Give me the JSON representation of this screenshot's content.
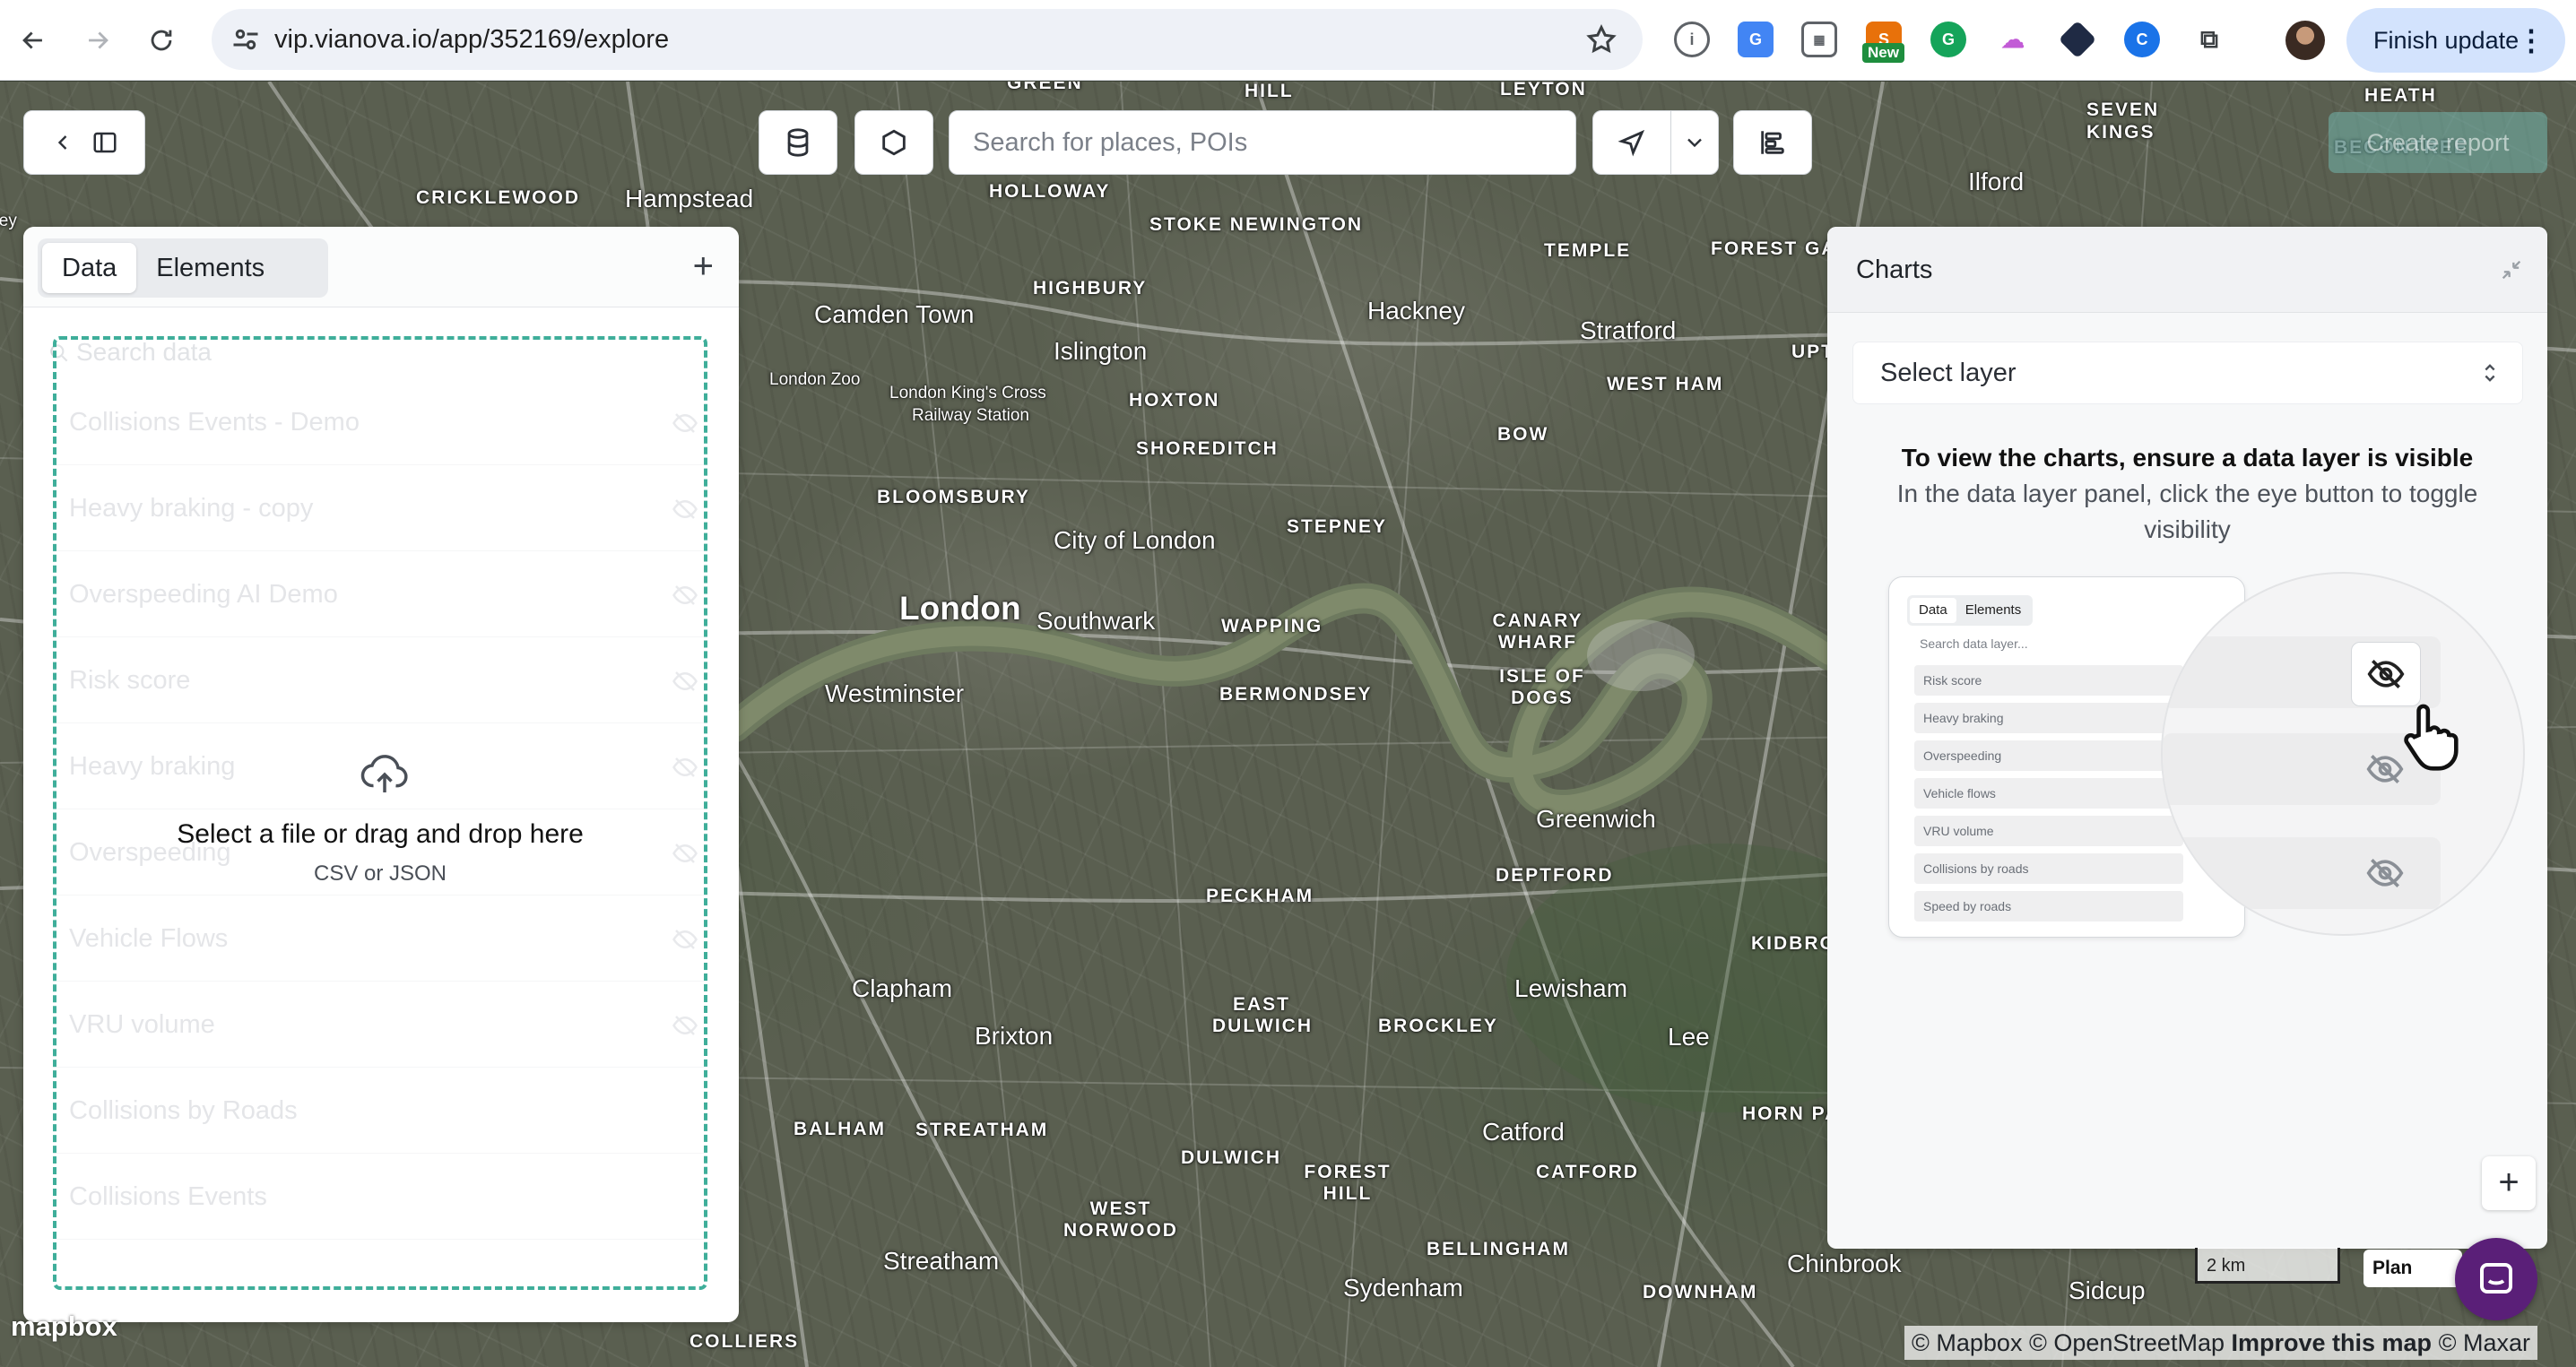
{
  "browser": {
    "url": "vip.vianova.io/app/352169/explore",
    "finish_update": "Finish update",
    "ext_new_badge": "New"
  },
  "toolbar": {
    "search_placeholder": "Search for places, POIs",
    "create_report": "Create report"
  },
  "left_panel": {
    "tabs": [
      {
        "label": "Data",
        "active": true
      },
      {
        "label": "Elements",
        "active": false
      }
    ],
    "search_placeholder": "Search data",
    "layers": [
      "Collisions Events - Demo",
      "Heavy braking - copy",
      "Overspeeding AI Demo",
      "Risk score",
      "Heavy braking",
      "Overspeeding",
      "Vehicle Flows",
      "VRU volume",
      "Collisions by Roads",
      "Collisions Events"
    ],
    "dropzone": {
      "title": "Select a file or drag and drop here",
      "subtitle": "CSV or JSON"
    }
  },
  "charts_panel": {
    "title": "Charts",
    "select_placeholder": "Select layer",
    "message_strong": "To view the charts, ensure a data layer is visible",
    "message_sub": "In the data layer panel, click the eye button to toggle visibility",
    "illustration": {
      "tabs": [
        "Data",
        "Elements"
      ],
      "search": "Search data layer...",
      "rows": [
        "Risk score",
        "Heavy braking",
        "Overspeeding",
        "Vehicle flows",
        "VRU volume",
        "Collisions by roads",
        "Speed by roads"
      ]
    }
  },
  "map": {
    "places_big": [
      "London",
      "Westminster",
      "Greenwich",
      "City of London",
      "Hampstead",
      "Stratford",
      "Islington",
      "Hackney",
      "Ilford",
      "Camden Town",
      "Southwark",
      "Lewisham",
      "Brixton",
      "Clapham",
      "Streatham",
      "Catford",
      "Sydenham",
      "Chinbrook",
      "Lee",
      "Sidcup"
    ],
    "places_area": [
      "GREEN",
      "HILL",
      "LEYTON",
      "SEVEN",
      "KINGS",
      "HEATH",
      "BECONTREE",
      "CRICKLEWOOD",
      "HOLLOWAY",
      "STOKE NEWINGTON",
      "HIGHBURY",
      "TEMPLE",
      "FOREST GATE",
      "UPTON",
      "HOXTON",
      "SHOREDITCH",
      "WEST HAM",
      "BOW",
      "BLOOMSBURY",
      "STEPNEY",
      "WAPPING",
      "CANARY WHARF",
      "ISLE OF DOGS",
      "BERMONDSEY",
      "PECKHAM",
      "DEPTFORD",
      "EAST DULWICH",
      "BROCKLEY",
      "BALHAM",
      "STREATHAM",
      "DULWICH",
      "WEST NORWOOD",
      "FOREST HILL",
      "BELLINGHAM",
      "CATFORD",
      "HORN PARK",
      "DOWNHAM",
      "KIDBROOK",
      "COLLIERS"
    ],
    "places_small": [
      "London Zoo",
      "London King's Cross",
      "Railway Station",
      "Wembley"
    ],
    "scale": "2 km",
    "plan": "Plan",
    "logo": "mapbox",
    "attribution": [
      "© Mapbox",
      "© OpenStreetMap",
      "Improve this map",
      "© Maxar"
    ]
  }
}
